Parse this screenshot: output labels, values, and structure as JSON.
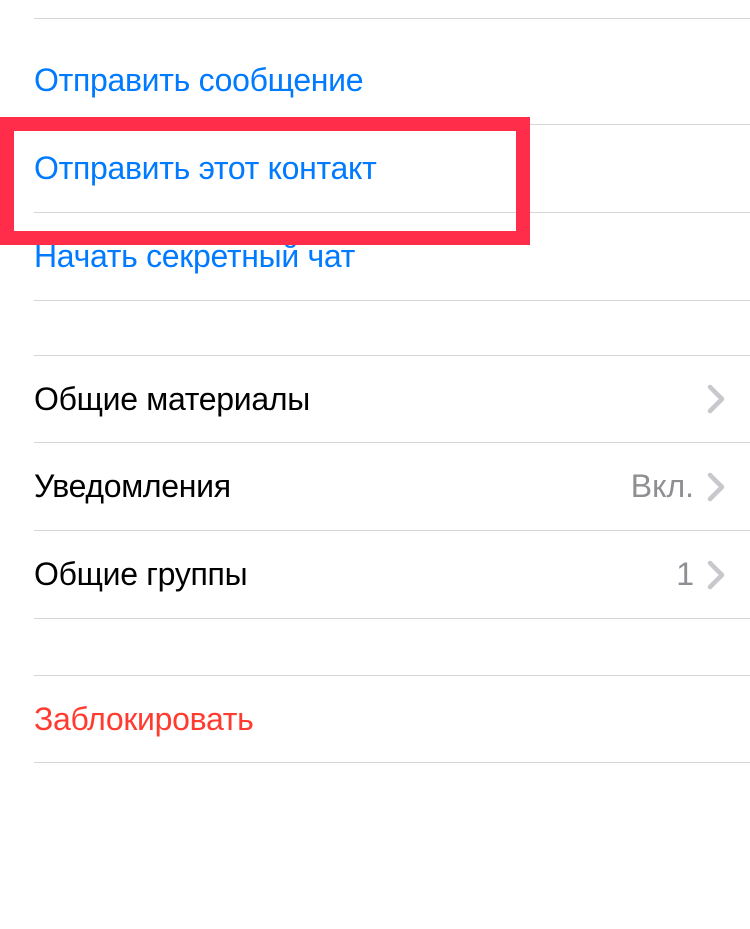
{
  "actions": {
    "send_message": "Отправить сообщение",
    "share_contact": "Отправить этот контакт",
    "start_secret_chat": "Начать секретный чат"
  },
  "settings": {
    "shared_media": "Общие материалы",
    "notifications_label": "Уведомления",
    "notifications_value": "Вкл.",
    "common_groups_label": "Общие группы",
    "common_groups_value": "1"
  },
  "block": {
    "label": "Заблокировать"
  },
  "colors": {
    "blue": "#007aff",
    "red": "#ff3b30",
    "gray": "#8e8e93",
    "highlight": "#ff2d4a"
  }
}
